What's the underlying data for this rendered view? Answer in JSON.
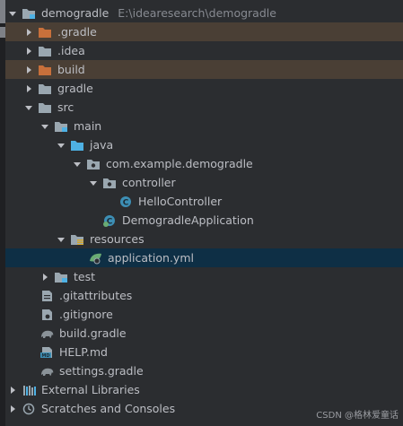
{
  "tree": {
    "root": {
      "label": "demogradle",
      "path": "E:\\idearesearch\\demogradle"
    },
    "items": [
      {
        "label": ".gradle"
      },
      {
        "label": ".idea"
      },
      {
        "label": "build"
      },
      {
        "label": "gradle"
      },
      {
        "label": "src"
      },
      {
        "label": "main"
      },
      {
        "label": "java"
      },
      {
        "label": "com.example.demogradle"
      },
      {
        "label": "controller"
      },
      {
        "label": "HelloController"
      },
      {
        "label": "DemogradleApplication"
      },
      {
        "label": "resources"
      },
      {
        "label": "application.yml"
      },
      {
        "label": "test"
      },
      {
        "label": ".gitattributes"
      },
      {
        "label": ".gitignore"
      },
      {
        "label": "build.gradle"
      },
      {
        "label": "HELP.md"
      },
      {
        "label": "settings.gradle"
      },
      {
        "label": "External Libraries"
      },
      {
        "label": "Scratches and Consoles"
      }
    ]
  },
  "icons": {
    "folder": "folder-icon",
    "excluded_folder": "excluded-folder-icon",
    "source_root": "source-root-icon",
    "package": "package-icon",
    "java_class": "java-class-icon",
    "spring_boot_app": "spring-boot-application-icon",
    "resources_root": "resources-root-icon",
    "spring_config": "spring-config-file-icon",
    "git_file": "git-file-icon",
    "gradle_file": "gradle-elephant-icon",
    "markdown": "markdown-icon",
    "libraries": "libraries-icon",
    "scratches": "scratches-icon"
  },
  "colors": {
    "background": "#2b2d30",
    "excluded_row": "#4a3f35",
    "selected_row": "#0e2f45",
    "folder": "#9aa7b0",
    "excluded_folder": "#c8703b",
    "source_blue": "#4eb1e4",
    "spring_green": "#6aab73"
  },
  "watermark": "CSDN @格林爱童话"
}
